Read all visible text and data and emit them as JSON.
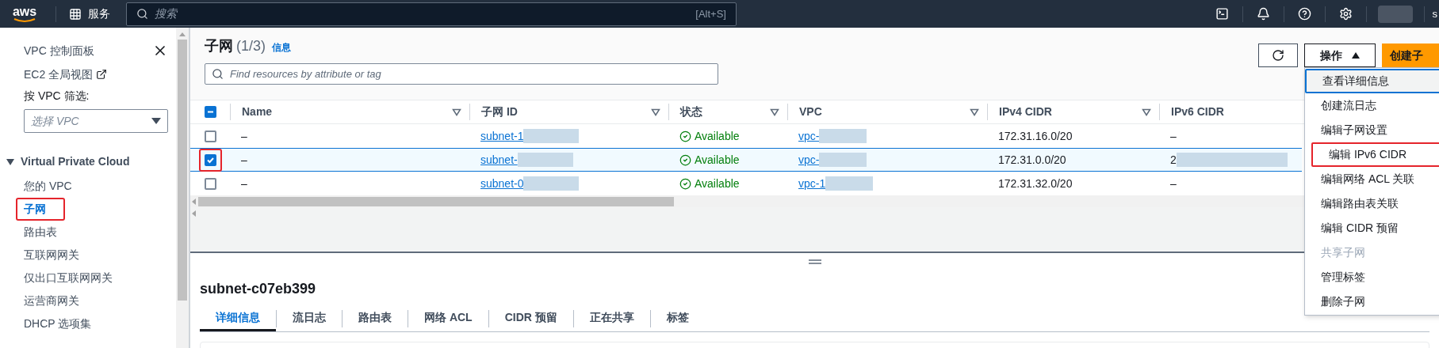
{
  "top_bar": {
    "logo": "aws",
    "services": "服务",
    "search": {
      "placeholder": "搜索",
      "shortcut": "[Alt+S]"
    },
    "account_label": "s"
  },
  "sidebar": {
    "links": [
      {
        "label": "VPC 控制面板",
        "kind": "close"
      },
      {
        "label": "EC2 全局视图",
        "kind": "external"
      }
    ],
    "filter": {
      "label": "按 VPC 筛选:",
      "placeholder": "选择 VPC"
    },
    "section": {
      "title": "Virtual Private Cloud",
      "expanded": true,
      "items": [
        {
          "label": "您的 VPC",
          "selected": false,
          "annotated": false
        },
        {
          "label": "子网",
          "selected": true,
          "annotated": true
        },
        {
          "label": "路由表",
          "selected": false,
          "annotated": false
        },
        {
          "label": "互联网网关",
          "selected": false,
          "annotated": false
        },
        {
          "label": "仅出口互联网网关",
          "selected": false,
          "annotated": false
        },
        {
          "label": "运营商网关",
          "selected": false,
          "annotated": false
        },
        {
          "label": "DHCP 选项集",
          "selected": false,
          "annotated": false
        }
      ]
    }
  },
  "panel": {
    "title": "子网",
    "count": "(1/3)",
    "info": "信息",
    "actions": "操作",
    "actions_expanded": true,
    "create": "创建子",
    "search": {
      "placeholder": "Find resources by attribute or tag"
    },
    "header_indeterminate": true,
    "columns": [
      "Name",
      "子网 ID",
      "状态",
      "VPC",
      "IPv4 CIDR",
      "IPv6 CIDR"
    ],
    "rows": [
      {
        "selected": false,
        "annotated": false,
        "name": "–",
        "subnet_id": "subnet-1",
        "status": "Available",
        "vpc": "vpc-",
        "ipv4": "172.31.16.0/20",
        "ipv6": "–"
      },
      {
        "selected": true,
        "annotated": true,
        "name": "–",
        "subnet_id": "subnet-",
        "status": "Available",
        "vpc": "vpc-",
        "ipv4": "172.31.0.0/20",
        "ipv6": "2"
      },
      {
        "selected": false,
        "annotated": false,
        "name": "–",
        "subnet_id": "subnet-0",
        "status": "Available",
        "vpc": "vpc-1",
        "ipv4": "172.31.32.0/20",
        "ipv6": "–"
      }
    ],
    "menu": [
      {
        "label": "查看详细信息",
        "focused": true,
        "disabled": false,
        "annotated": false
      },
      {
        "label": "创建流日志",
        "focused": false,
        "disabled": false,
        "annotated": false
      },
      {
        "label": "编辑子网设置",
        "focused": false,
        "disabled": false,
        "annotated": false
      },
      {
        "label": "编辑 IPv6 CIDR",
        "focused": false,
        "disabled": false,
        "annotated": true
      },
      {
        "label": "编辑网络 ACL 关联",
        "focused": false,
        "disabled": false,
        "annotated": false
      },
      {
        "label": "编辑路由表关联",
        "focused": false,
        "disabled": false,
        "annotated": false
      },
      {
        "label": "编辑 CIDR 预留",
        "focused": false,
        "disabled": false,
        "annotated": false
      },
      {
        "label": "共享子网",
        "focused": false,
        "disabled": true,
        "annotated": false
      },
      {
        "label": "管理标签",
        "focused": false,
        "disabled": false,
        "annotated": false
      },
      {
        "label": "删除子网",
        "focused": false,
        "disabled": false,
        "annotated": false
      }
    ]
  },
  "details": {
    "title": "subnet-c07eb399",
    "tabs": [
      {
        "label": "详细信息",
        "selected": true
      },
      {
        "label": "流日志",
        "selected": false
      },
      {
        "label": "路由表",
        "selected": false
      },
      {
        "label": "网络 ACL",
        "selected": false
      },
      {
        "label": "CIDR 预留",
        "selected": false
      },
      {
        "label": "正在共享",
        "selected": false
      },
      {
        "label": "标签",
        "selected": false
      }
    ]
  }
}
